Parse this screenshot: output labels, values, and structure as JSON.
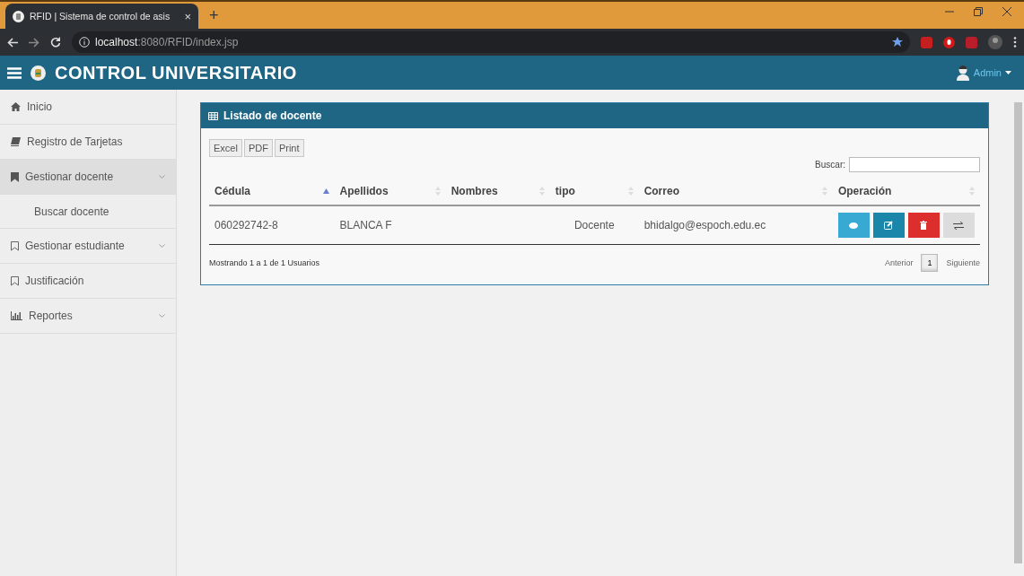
{
  "browser": {
    "tab_title": "RFID | Sistema de control de asis",
    "tab_close": "×",
    "new_tab": "+",
    "url_host": "localhost",
    "url_rest": ":8080/RFID/index.jsp"
  },
  "header": {
    "title": "CONTROL UNIVERSITARIO",
    "user": "Admin"
  },
  "sidebar": {
    "items": [
      {
        "label": "Inicio",
        "kind": "home",
        "selected": false,
        "expandable": false
      },
      {
        "label": "Registro de Tarjetas",
        "kind": "book",
        "selected": false,
        "expandable": false
      },
      {
        "label": "Gestionar docente",
        "kind": "bookmark",
        "selected": true,
        "expandable": true,
        "children": [
          {
            "label": "Buscar docente"
          }
        ]
      },
      {
        "label": "Gestionar estudiante",
        "kind": "outline",
        "selected": false,
        "expandable": true
      },
      {
        "label": "Justificación",
        "kind": "outline",
        "selected": false,
        "expandable": false
      },
      {
        "label": "Reportes",
        "kind": "chart",
        "selected": false,
        "expandable": true
      }
    ]
  },
  "panel": {
    "title": "Listado de docente",
    "export_buttons": [
      "Excel",
      "PDF",
      "Print"
    ],
    "search_label": "Buscar:",
    "table": {
      "columns": [
        {
          "label": "Cédula",
          "sorted": true
        },
        {
          "label": "Apellidos",
          "sorted": false
        },
        {
          "label": "Nombres",
          "sorted": false
        },
        {
          "label": "tipo",
          "sorted": false
        },
        {
          "label": "Correo",
          "sorted": false
        },
        {
          "label": "Operación",
          "sorted": false
        }
      ],
      "rows": [
        {
          "cells": [
            "060292742-8",
            "BLANCA F",
            "",
            "Docente",
            "bhidalgo@espoch.edu.ec"
          ],
          "operations": [
            {
              "kind": "view"
            },
            {
              "kind": "edit"
            },
            {
              "kind": "delete"
            },
            {
              "kind": "swap"
            }
          ]
        }
      ]
    },
    "info": "Mostrando 1 a 1 de 1 Usuarios",
    "pagination": {
      "previous": "Anterior",
      "pages": [
        {
          "label": "1",
          "selected": true
        }
      ],
      "next": "Siguiente"
    }
  }
}
